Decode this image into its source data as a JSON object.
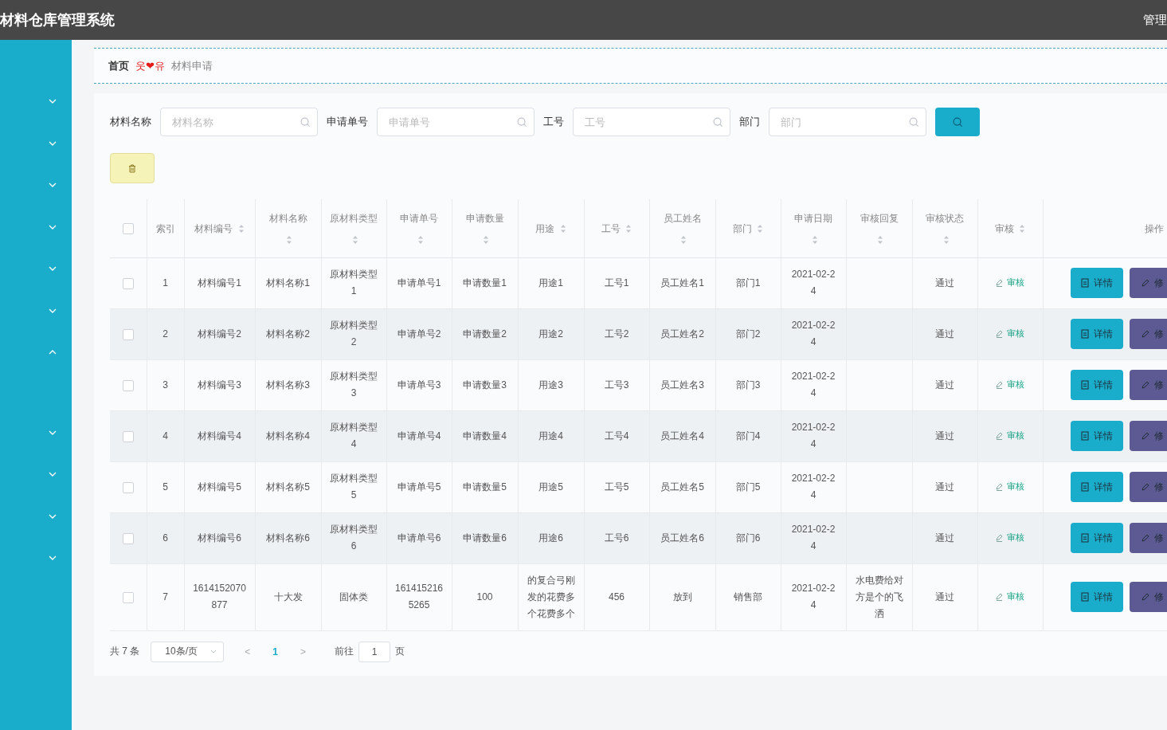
{
  "header": {
    "title": "材料仓库管理系统",
    "user": "管理"
  },
  "sidebar": {
    "items": [
      {
        "expanded": false
      },
      {
        "expanded": false
      },
      {
        "expanded": false
      },
      {
        "expanded": false
      },
      {
        "expanded": false
      },
      {
        "expanded": false
      },
      {
        "expanded": true
      },
      {
        "expanded": false
      },
      {
        "expanded": false
      },
      {
        "expanded": false
      },
      {
        "expanded": false
      }
    ]
  },
  "breadcrumb": {
    "home": "首页",
    "separator": "웃❤유",
    "current": "材料申请"
  },
  "search": {
    "fields": [
      {
        "label": "材料名称",
        "placeholder": "材料名称"
      },
      {
        "label": "申请单号",
        "placeholder": "申请单号"
      },
      {
        "label": "工号",
        "placeholder": "工号"
      },
      {
        "label": "部门",
        "placeholder": "部门"
      }
    ]
  },
  "table": {
    "select_all": {
      "checked": false
    },
    "columns": [
      {
        "label": "索引",
        "sortable": false
      },
      {
        "label": "材料编号",
        "sortable": true
      },
      {
        "label": "材料名称",
        "sortable": true
      },
      {
        "label": "原材料类型",
        "sortable": true
      },
      {
        "label": "申请单号",
        "sortable": true
      },
      {
        "label": "申请数量",
        "sortable": true
      },
      {
        "label": "用途",
        "sortable": true
      },
      {
        "label": "工号",
        "sortable": true
      },
      {
        "label": "员工姓名",
        "sortable": true
      },
      {
        "label": "部门",
        "sortable": true
      },
      {
        "label": "申请日期",
        "sortable": true
      },
      {
        "label": "审核回复",
        "sortable": true
      },
      {
        "label": "审核状态",
        "sortable": true
      },
      {
        "label": "审核",
        "sortable": true
      },
      {
        "label": "操作",
        "sortable": false
      }
    ],
    "rows": [
      {
        "checked": false,
        "index": "1",
        "code": "材料编号1",
        "name": "材料名称1",
        "material_type": "原材料类型1",
        "apply_no": "申请单号1",
        "quantity": "申请数量1",
        "purpose": "用途1",
        "staff_no": "工号1",
        "staff_name": "员工姓名1",
        "department": "部门1",
        "apply_date": "2021-02-24",
        "audit_status": "通过",
        "audit_link": "审核",
        "actions": [
          {
            "kind": "detail",
            "label": "详情"
          },
          {
            "kind": "edit",
            "label": "修"
          }
        ]
      },
      {
        "checked": false,
        "index": "2",
        "code": "材料编号2",
        "name": "材料名称2",
        "material_type": "原材料类型2",
        "apply_no": "申请单号2",
        "quantity": "申请数量2",
        "purpose": "用途2",
        "staff_no": "工号2",
        "staff_name": "员工姓名2",
        "department": "部门2",
        "apply_date": "2021-02-24",
        "audit_status": "通过",
        "audit_link": "审核",
        "actions": [
          {
            "kind": "detail",
            "label": "详情"
          },
          {
            "kind": "edit",
            "label": "修"
          }
        ]
      },
      {
        "checked": false,
        "index": "3",
        "code": "材料编号3",
        "name": "材料名称3",
        "material_type": "原材料类型3",
        "apply_no": "申请单号3",
        "quantity": "申请数量3",
        "purpose": "用途3",
        "staff_no": "工号3",
        "staff_name": "员工姓名3",
        "department": "部门3",
        "apply_date": "2021-02-24",
        "audit_status": "通过",
        "audit_link": "审核",
        "actions": [
          {
            "kind": "detail",
            "label": "详情"
          },
          {
            "kind": "edit",
            "label": "修"
          }
        ]
      },
      {
        "checked": false,
        "index": "4",
        "code": "材料编号4",
        "name": "材料名称4",
        "material_type": "原材料类型4",
        "apply_no": "申请单号4",
        "quantity": "申请数量4",
        "purpose": "用途4",
        "staff_no": "工号4",
        "staff_name": "员工姓名4",
        "department": "部门4",
        "apply_date": "2021-02-24",
        "audit_status": "通过",
        "audit_link": "审核",
        "actions": [
          {
            "kind": "detail",
            "label": "详情"
          },
          {
            "kind": "edit",
            "label": "修"
          }
        ]
      },
      {
        "checked": false,
        "index": "5",
        "code": "材料编号5",
        "name": "材料名称5",
        "material_type": "原材料类型5",
        "apply_no": "申请单号5",
        "quantity": "申请数量5",
        "purpose": "用途5",
        "staff_no": "工号5",
        "staff_name": "员工姓名5",
        "department": "部门5",
        "apply_date": "2021-02-24",
        "audit_status": "通过",
        "audit_link": "审核",
        "actions": [
          {
            "kind": "detail",
            "label": "详情"
          },
          {
            "kind": "edit",
            "label": "修"
          }
        ]
      },
      {
        "checked": false,
        "index": "6",
        "code": "材料编号6",
        "name": "材料名称6",
        "material_type": "原材料类型6",
        "apply_no": "申请单号6",
        "quantity": "申请数量6",
        "purpose": "用途6",
        "staff_no": "工号6",
        "staff_name": "员工姓名6",
        "department": "部门6",
        "apply_date": "2021-02-24",
        "audit_status": "通过",
        "audit_link": "审核",
        "actions": [
          {
            "kind": "detail",
            "label": "详情"
          },
          {
            "kind": "edit",
            "label": "修"
          }
        ]
      },
      {
        "checked": false,
        "index": "7",
        "code": "1614152070877",
        "name": "十大发",
        "material_type": "固体类",
        "apply_no": "1614152165265",
        "quantity": "100",
        "purpose": "的复合弓刚发的花费多个花费多个",
        "staff_no": "456",
        "staff_name": "放到",
        "department": "销售部",
        "apply_date": "2021-02-24",
        "audit_reply": "水电费给对方是个的飞洒",
        "audit_status": "通过",
        "audit_link": "审核",
        "actions": [
          {
            "kind": "detail",
            "label": "详情"
          },
          {
            "kind": "edit",
            "label": "修"
          }
        ]
      }
    ]
  },
  "pagination": {
    "total": "共 7 条",
    "page_size": "10条/页",
    "prev": "<",
    "pages": [
      {
        "label": "1",
        "selected": true
      }
    ],
    "next": ">",
    "goto_label": "前往",
    "goto_value": "1",
    "goto_suffix": "页"
  }
}
